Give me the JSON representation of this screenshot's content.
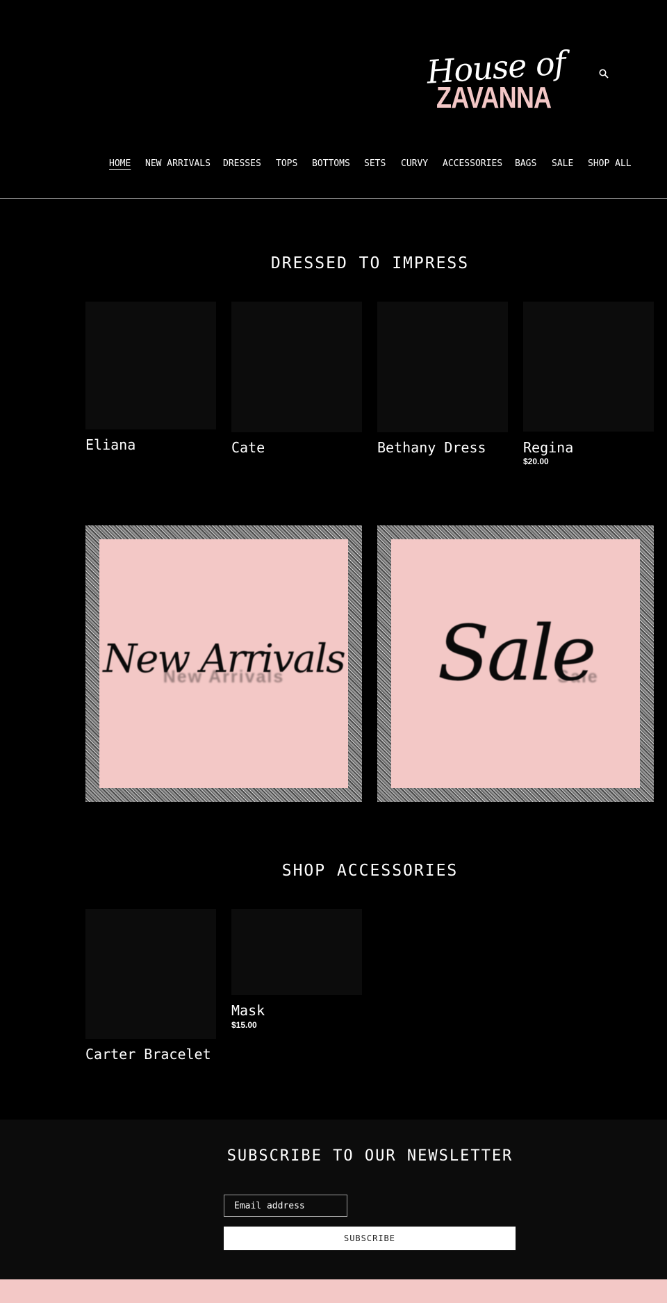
{
  "brand": {
    "logo_script": "House of",
    "logo_name": "ZAVANNA"
  },
  "header": {
    "search_icon": "search-icon"
  },
  "nav": [
    {
      "label": "HOME",
      "active": true
    },
    {
      "label": "NEW ARRIVALS"
    },
    {
      "label": "DRESSES"
    },
    {
      "label": "TOPS"
    },
    {
      "label": "BOTTOMS"
    },
    {
      "label": "SETS"
    },
    {
      "label": "CURVY"
    },
    {
      "label": "ACCESSORIES"
    },
    {
      "label": "BAGS"
    },
    {
      "label": "SALE"
    },
    {
      "label": "SHOP ALL"
    }
  ],
  "featured": {
    "title": "DRESSED TO IMPRESS",
    "products": [
      {
        "title": "Eliana"
      },
      {
        "title": "Cate"
      },
      {
        "title": "Bethany Dress"
      },
      {
        "title": "Regina",
        "price": "$20.00"
      }
    ]
  },
  "promos": [
    {
      "script": "New Arrivals",
      "alt": "New Arrivals"
    },
    {
      "script": "Sale",
      "alt": "Sale"
    }
  ],
  "accessories": {
    "title": "SHOP ACCESSORIES",
    "products": [
      {
        "title": "Carter Bracelet"
      },
      {
        "title": "Mask",
        "price": "$15.00"
      }
    ]
  },
  "newsletter": {
    "title": "SUBSCRIBE TO OUR NEWSLETTER",
    "email_placeholder": "Email address",
    "button_label": "SUBSCRIBE"
  },
  "colors": {
    "background": "#000000",
    "accent_pink": "#f3c8c6",
    "card": "#0c0c0c"
  }
}
